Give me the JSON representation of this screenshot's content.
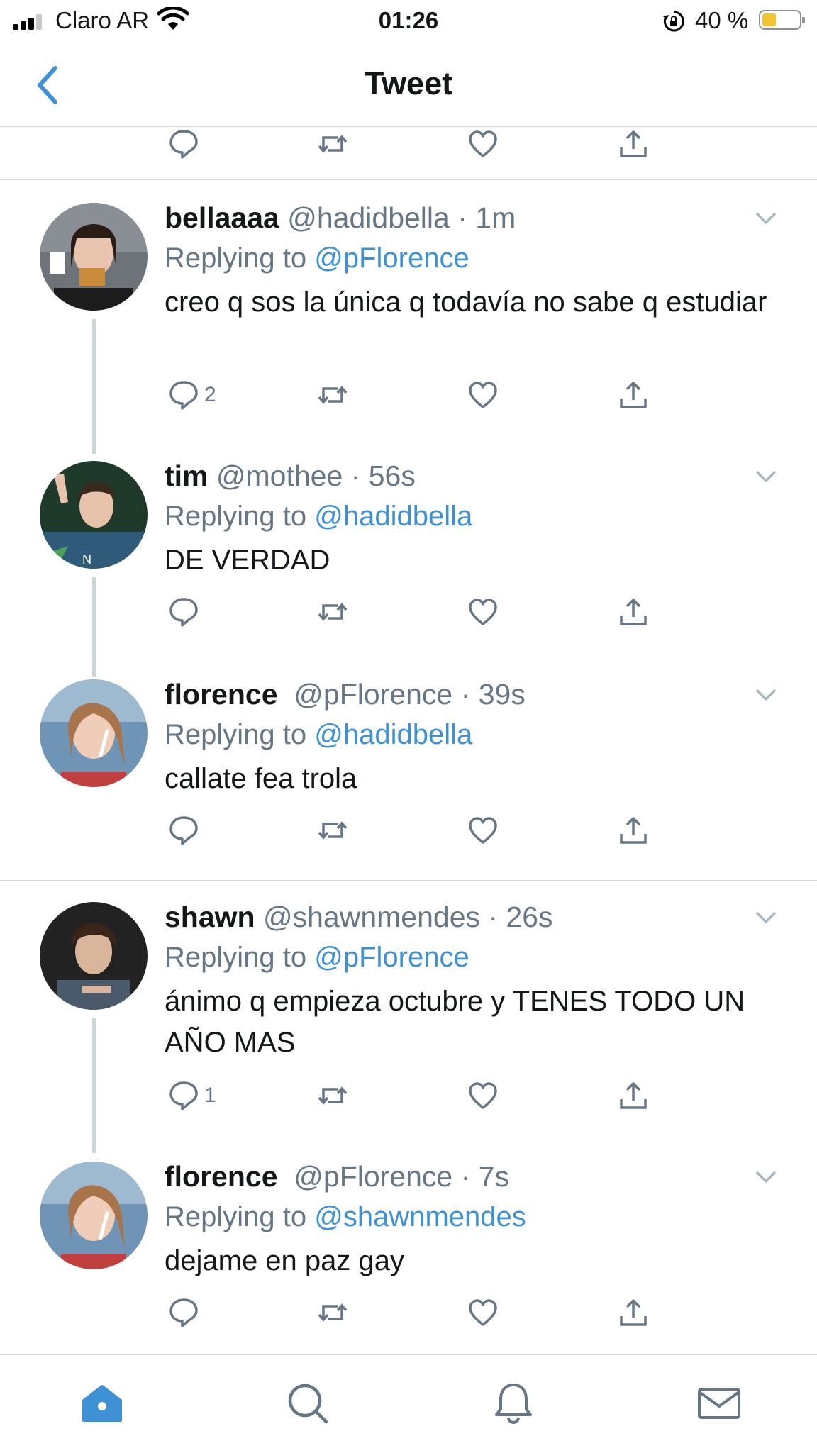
{
  "status_bar": {
    "carrier": "Claro AR",
    "time": "01:26",
    "battery_percent": "40 %",
    "battery_level": 0.4
  },
  "nav": {
    "title": "Tweet",
    "back_icon": "chevron-left-icon"
  },
  "replying_prefix": "Replying to",
  "tweets": [
    {
      "name": "bellaaaa",
      "handle": "@hadidbella",
      "time": "1m",
      "replying_to": "@pFlorence",
      "text": "creo q sos la única q todavía no sabe q estudiar",
      "reply_count": "2"
    },
    {
      "name": "tim",
      "handle": "@mothee",
      "time": "56s",
      "replying_to": "@hadidbella",
      "text": "DE VERDAD",
      "reply_count": ""
    },
    {
      "name": "florence",
      "handle": "@pFlorence",
      "time": "39s",
      "replying_to": "@hadidbella",
      "text": "callate fea trola",
      "reply_count": ""
    },
    {
      "name": "shawn",
      "handle": "@shawnmendes",
      "time": "26s",
      "replying_to": "@pFlorence",
      "text": "ánimo q empieza octubre y TENES TODO UN AÑO MAS",
      "reply_count": "1"
    },
    {
      "name": "florence",
      "handle": "@pFlorence",
      "time": "7s",
      "replying_to": "@shawnmendes",
      "text": "dejame en paz gay",
      "reply_count": ""
    }
  ],
  "tab_bar": [
    "home-icon",
    "search-icon",
    "notifications-icon",
    "messages-icon"
  ],
  "colors": {
    "accent": "#3f91d6",
    "secondary_text": "#657786",
    "divider": "#d0d6db"
  }
}
